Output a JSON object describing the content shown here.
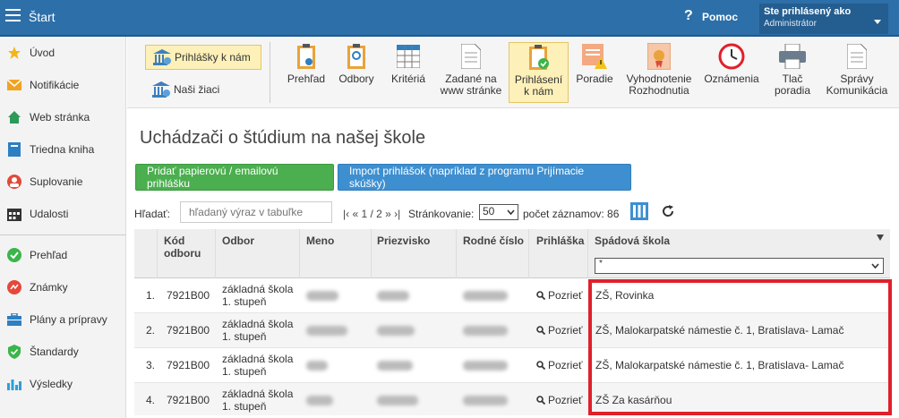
{
  "topbar": {
    "title": "Štart",
    "help_icon": "?",
    "help_label": "Pomoc",
    "user_line1": "Ste prihlásený ako",
    "user_line2": "Administrátor"
  },
  "sidebar": {
    "items": [
      {
        "label": "Úvod",
        "icon": "star-icon"
      },
      {
        "label": "Notifikácie",
        "icon": "envelope-icon"
      },
      {
        "label": "Web stránka",
        "icon": "house-icon"
      },
      {
        "label": "Triedna kniha",
        "icon": "book-icon"
      },
      {
        "label": "Suplovanie",
        "icon": "user-swap-icon"
      },
      {
        "label": "Udalosti",
        "icon": "calendar-icon"
      },
      {
        "label": "Prehľad",
        "icon": "check-circle-icon"
      },
      {
        "label": "Známky",
        "icon": "grade-icon"
      },
      {
        "label": "Plány a prípravy",
        "icon": "briefcase-icon"
      },
      {
        "label": "Štandardy",
        "icon": "shield-check-icon"
      },
      {
        "label": "Výsledky",
        "icon": "bar-chart-icon"
      }
    ]
  },
  "toolbar": {
    "left_tabs": [
      {
        "label": "Prihlášky k nám",
        "active": true
      },
      {
        "label": "Naši žiaci",
        "active": false
      }
    ],
    "tools": [
      {
        "line1": "Prehľad",
        "line2": ""
      },
      {
        "line1": "Odbory",
        "line2": ""
      },
      {
        "line1": "Kritériá",
        "line2": ""
      },
      {
        "line1": "Zadané na",
        "line2": "www stránke"
      },
      {
        "line1": "Prihlásení",
        "line2": "k nám"
      },
      {
        "line1": "Poradie",
        "line2": ""
      },
      {
        "line1": "Vyhodnotenie",
        "line2": "Rozhodnutia"
      },
      {
        "line1": "Oznámenia",
        "line2": ""
      },
      {
        "line1": "Tlač",
        "line2": "poradia"
      },
      {
        "line1": "Správy",
        "line2": "Komunikácia"
      }
    ]
  },
  "main": {
    "title": "Uchádzači o štúdium na našej škole",
    "btn_add": "Pridať papierovú / emailovú prihlášku",
    "btn_import": "Import prihlášok (napríklad z programu Prijímacie skúšky)",
    "search_label": "Hľadať:",
    "search_placeholder": "hľadaný výraz v tabuľke",
    "pager_text": "|‹ « 1 / 2 » ›|",
    "pager_label": "Stránkovanie:",
    "pager_value": "50",
    "count_text": "počet záznamov: 86"
  },
  "table": {
    "headers": {
      "kod": "Kód",
      "kod2": "odboru",
      "odbor": "Odbor",
      "meno": "Meno",
      "priezvisko": "Priezvisko",
      "rodne": "Rodné číslo",
      "prihlaska": "Prihláška",
      "spadova": "Spádová škola"
    },
    "filter_value": "*",
    "rows": [
      {
        "num": "1.",
        "kod": "7921B00",
        "odbor1": "základná škola",
        "odbor2": "1. stupeň",
        "view": "Pozrieť",
        "spadova": "ZŠ, Rovinka"
      },
      {
        "num": "2.",
        "kod": "7921B00",
        "odbor1": "základná škola",
        "odbor2": "1. stupeň",
        "view": "Pozrieť",
        "spadova": "ZŠ, Malokarpatské námestie č. 1, Bratislava- Lamač"
      },
      {
        "num": "3.",
        "kod": "7921B00",
        "odbor1": "základná škola",
        "odbor2": "1. stupeň",
        "view": "Pozrieť",
        "spadova": "ZŠ, Malokarpatské námestie č. 1, Bratislava- Lamač"
      },
      {
        "num": "4.",
        "kod": "7921B00",
        "odbor1": "základná škola",
        "odbor2": "1. stupeň",
        "view": "Pozrieť",
        "spadova": "ZŠ Za kasárňou"
      }
    ]
  },
  "colors": {
    "topbar": "#2d6fa8",
    "active_tab": "#fdf0b8",
    "btn_green": "#4bae4f",
    "btn_blue": "#3d8fd0",
    "highlight": "#e0202a"
  }
}
